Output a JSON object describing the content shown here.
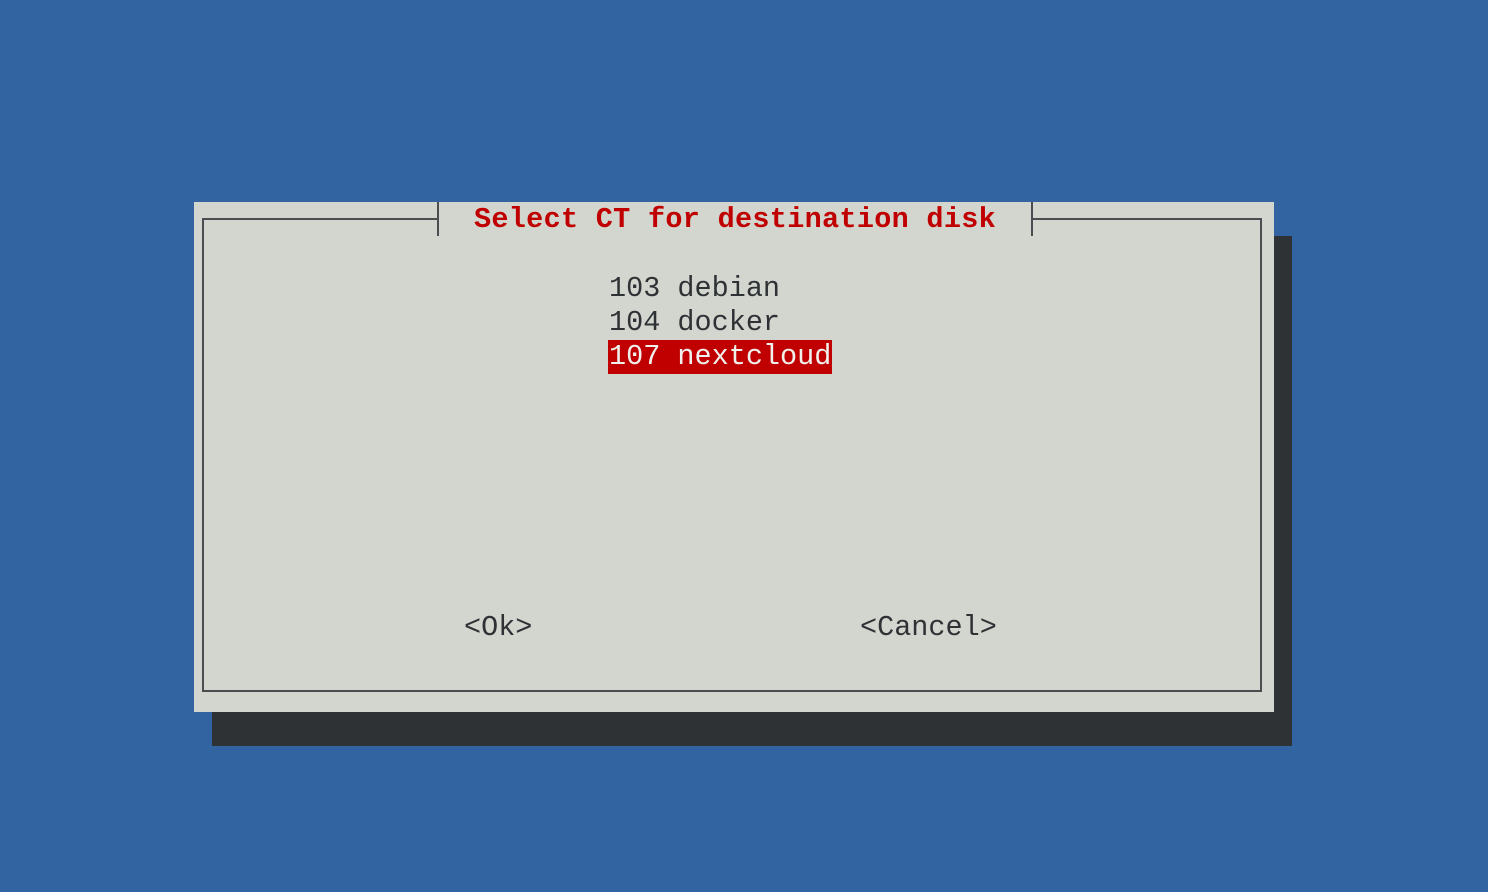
{
  "dialog": {
    "title": "Select CT for destination disk",
    "items": [
      {
        "label": "103 debian",
        "selected": false
      },
      {
        "label": "104 docker",
        "selected": false
      },
      {
        "label": "107 nextcloud",
        "selected": true
      }
    ],
    "ok_label": "<Ok>",
    "cancel_label": "<Cancel>"
  },
  "colors": {
    "background": "#3264a2",
    "dialog": "#d3d6cf",
    "shadow": "#2e3235",
    "accent": "#c00000"
  }
}
